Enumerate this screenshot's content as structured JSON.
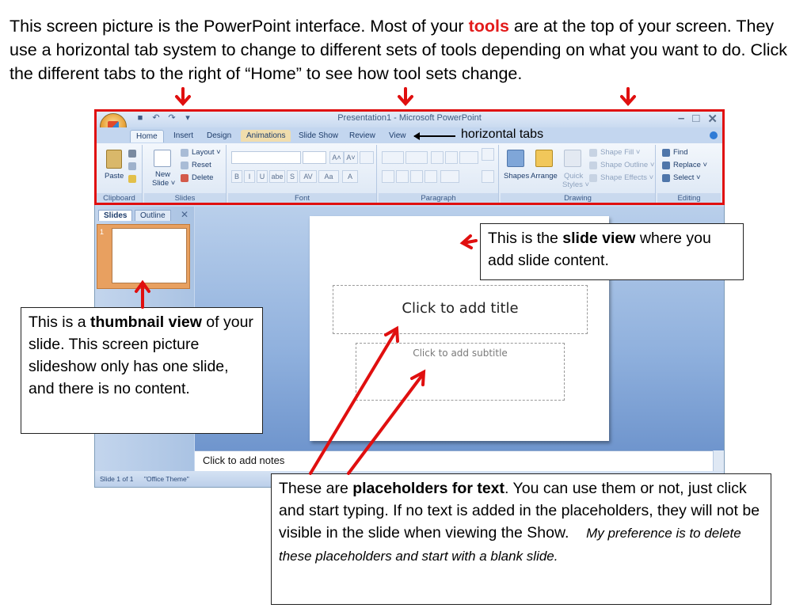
{
  "intro": {
    "before": "This screen picture is the PowerPoint interface. Most of your ",
    "highlight": "tools",
    "after": " are at the top of your screen. They use a horizontal tab system to change to different sets of tools depending on what you want to do. Click the different tabs to the right of “Home” to see how tool sets change."
  },
  "window": {
    "title": "Presentation1 - Microsoft PowerPoint",
    "qat": [
      "■",
      "↶",
      "↷",
      "▾"
    ],
    "controls": [
      "–",
      "□",
      "✕"
    ]
  },
  "tabs": {
    "items": [
      "Home",
      "Insert",
      "Design",
      "Animations",
      "Slide Show",
      "Review",
      "View"
    ],
    "annotation": "horizontal tabs"
  },
  "ribbon": {
    "clipboard": {
      "paste": "Paste",
      "label": "Clipboard"
    },
    "slides": {
      "new_slide": "New",
      "new_slide_2": "Slide ˅",
      "layout": "Layout ˅",
      "reset": "Reset",
      "delete": "Delete",
      "label": "Slides"
    },
    "font": {
      "label": "Font",
      "grow": "A˄",
      "shrink": "A˅",
      "bold": "B",
      "italic": "I",
      "underline": "U",
      "strike": "abe",
      "shadow": "S",
      "spacing": "AV",
      "case": "Aa",
      "color": "A"
    },
    "paragraph": {
      "label": "Paragraph"
    },
    "drawing": {
      "shapes": "Shapes",
      "arrange": "Arrange",
      "quick": "Quick",
      "quick2": "Styles ˅",
      "fill": "Shape Fill ˅",
      "outline": "Shape Outline ˅",
      "effects": "Shape Effects ˅",
      "label": "Drawing"
    },
    "editing": {
      "find": "Find",
      "replace": "Replace ˅",
      "select": "Select ˅",
      "label": "Editing"
    }
  },
  "left_pane": {
    "tabs": [
      "Slides",
      "Outline"
    ],
    "close": "✕",
    "slide_number": "1"
  },
  "slide": {
    "title_placeholder": "Click to add title",
    "subtitle_placeholder": "Click to add subtitle"
  },
  "notes": {
    "placeholder": "Click to add notes"
  },
  "status": {
    "slide": "Slide 1 of 1",
    "theme": "\"Office Theme\""
  },
  "callouts": {
    "slide_view": {
      "a": "This is the ",
      "b": "slide view",
      "c": " where you add slide content."
    },
    "thumbnail": {
      "a": "This is a ",
      "b": "thumbnail view",
      "c": " of your slide. This screen picture slideshow only has one slide, and there is no content."
    },
    "placeholders": {
      "a": "These are ",
      "b": "placeholders for text",
      "c": ". You can use them or not, just click and start typing. If no text is added in the placeholders, they will not be visible in the slide when viewing the Show.",
      "d": "My preference is to delete these placeholders and start with a blank slide."
    }
  },
  "colors": {
    "annotation_red": "#e00f0f",
    "tools_highlight": "#e31b1b"
  }
}
